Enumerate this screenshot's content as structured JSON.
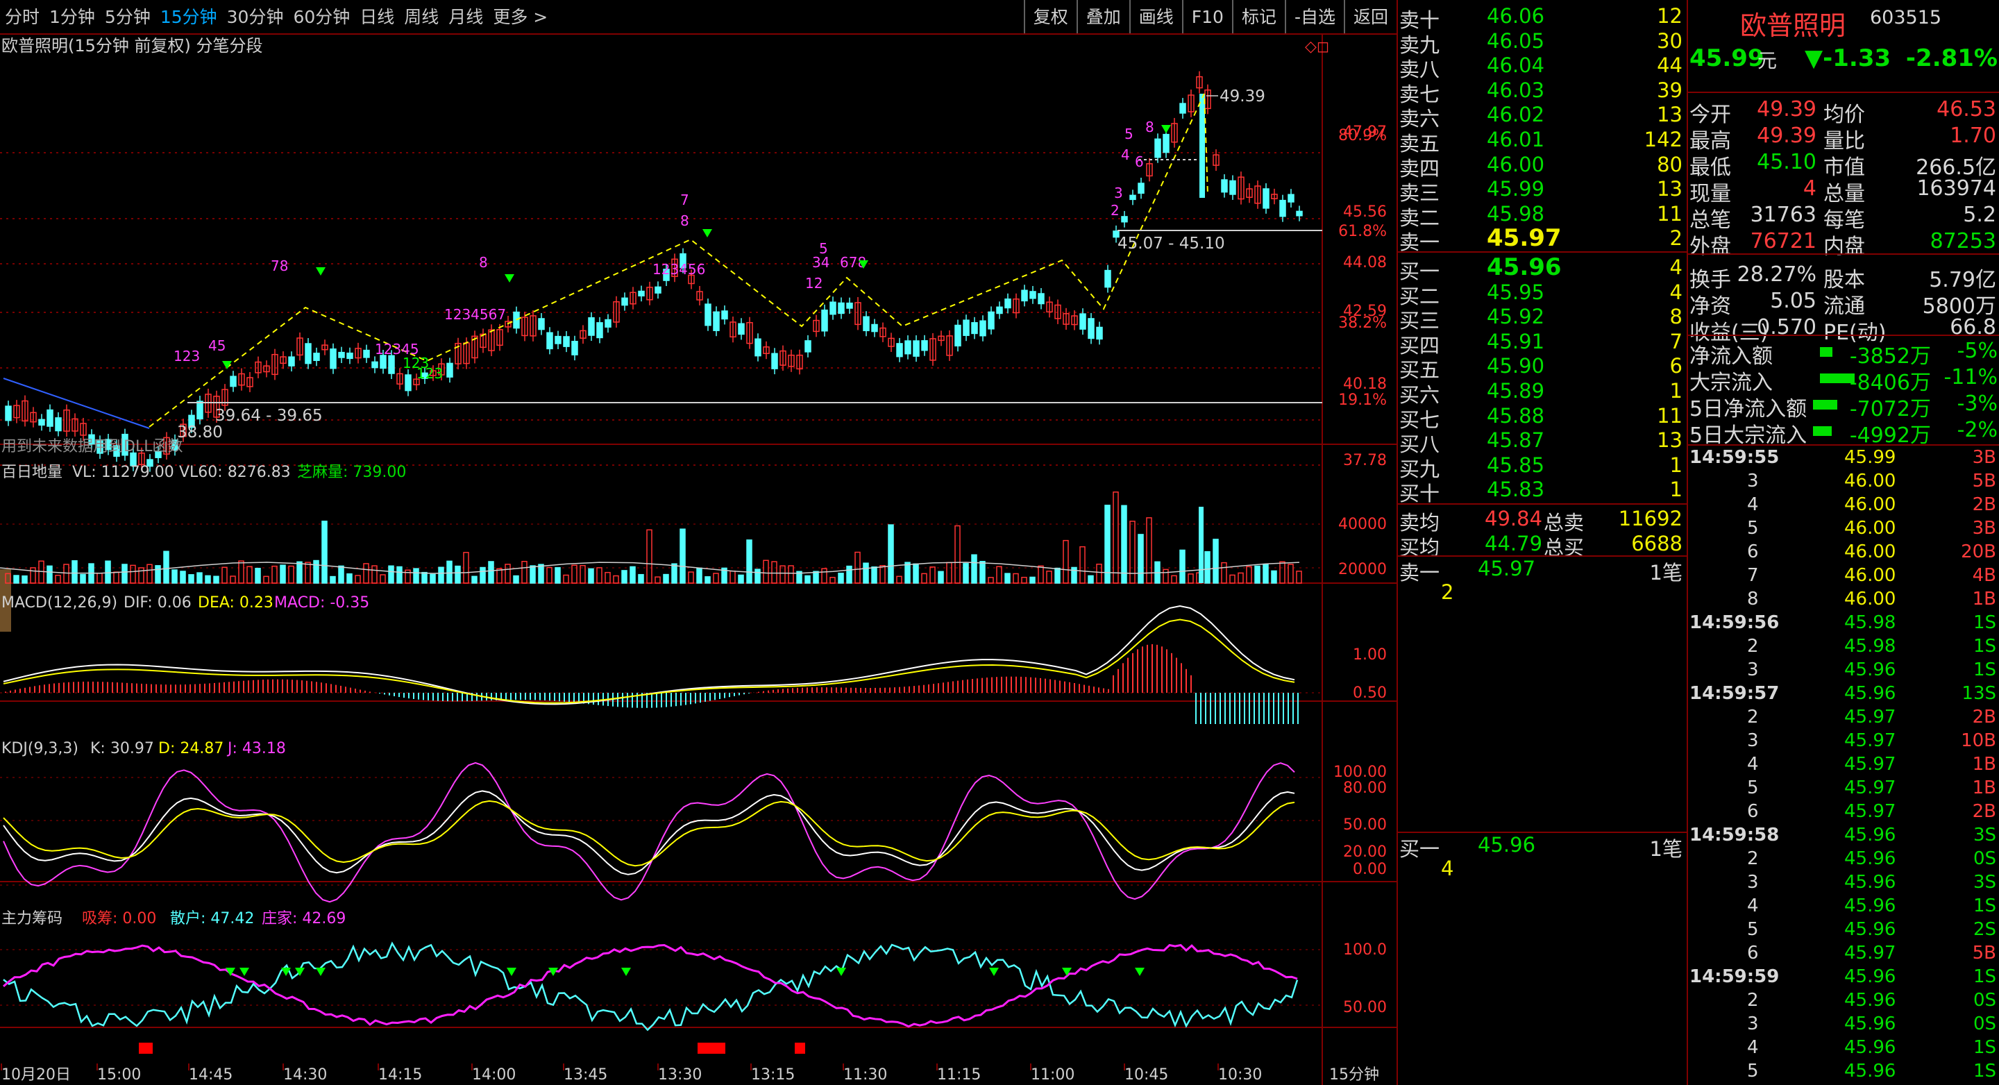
{
  "toolbar": {
    "periods": [
      "分时",
      "1分钟",
      "5分钟",
      "15分钟",
      "30分钟",
      "60分钟",
      "日线",
      "周线",
      "月线",
      "更多 >"
    ],
    "active": 3,
    "right": [
      "复权",
      "叠加",
      "画线",
      "F10",
      "标记",
      "-自选",
      "返回"
    ]
  },
  "main": {
    "title": "欧普照明(15分钟 前复权) 分笔分段",
    "pct_labels": [
      "80.9%",
      "61.8%",
      "38.2%",
      "19.1%"
    ],
    "price_labels": [
      "47.97",
      "45.56",
      "44.08",
      "42.59",
      "40.18",
      "37.78"
    ],
    "hi_label": "49.39",
    "lo_label": "38.80",
    "range1": "45.07 - 45.10",
    "range2": "39.64 - 39.65",
    "note": "用到未来数据用到DLL函数"
  },
  "vol": {
    "name": "百日地量",
    "vl": "VL: 11279.00",
    "vl60": "VL60: 8276.83",
    "zm": "芝麻量: 739.00",
    "ticks": [
      "40000",
      "20000"
    ]
  },
  "macd": {
    "name": "MACD(12,26,9)",
    "dif": "DIF: 0.06",
    "dea": "DEA: 0.23",
    "macd": "MACD: -0.35",
    "ticks": [
      "1.00",
      "0.50"
    ]
  },
  "kdj": {
    "name": "KDJ(9,3,3)",
    "k": "K: 30.97",
    "d": "D: 24.87",
    "j": "J: 43.18",
    "ticks": [
      "100.00",
      "80.00",
      "50.00",
      "20.00",
      "0.00"
    ]
  },
  "zl": {
    "name": "主力筹码",
    "xc": "吸筹: 0.00",
    "sh": "散户: 47.42",
    "zj": "庄家: 42.69",
    "ticks": [
      "100.0",
      "50.00"
    ]
  },
  "xaxis": {
    "labels": [
      "10月20日",
      "15:00",
      "14:45",
      "14:30",
      "14:15",
      "14:00",
      "13:45",
      "13:30",
      "13:15",
      "11:30",
      "11:15",
      "11:00",
      "10:45",
      "10:30"
    ],
    "period": "15分钟"
  },
  "orderbook": {
    "sells": [
      [
        "卖十",
        "46.06",
        "12"
      ],
      [
        "卖九",
        "46.05",
        "30"
      ],
      [
        "卖八",
        "46.04",
        "44"
      ],
      [
        "卖七",
        "46.03",
        "39"
      ],
      [
        "卖六",
        "46.02",
        "13"
      ],
      [
        "卖五",
        "46.01",
        "142"
      ],
      [
        "卖四",
        "46.00",
        "80"
      ],
      [
        "卖三",
        "45.99",
        "13"
      ],
      [
        "卖二",
        "45.98",
        "11"
      ],
      [
        "卖一",
        "45.97",
        "2"
      ]
    ],
    "buys": [
      [
        "买一",
        "45.96",
        "4"
      ],
      [
        "买二",
        "45.95",
        "4"
      ],
      [
        "买三",
        "45.92",
        "8"
      ],
      [
        "买四",
        "45.91",
        "7"
      ],
      [
        "买五",
        "45.90",
        "6"
      ],
      [
        "买六",
        "45.89",
        "1"
      ],
      [
        "买七",
        "45.88",
        "11"
      ],
      [
        "买八",
        "45.87",
        "13"
      ],
      [
        "买九",
        "45.85",
        "1"
      ],
      [
        "买十",
        "45.83",
        "1"
      ]
    ],
    "avg_sell_label": "卖均",
    "avg_sell": "49.84",
    "total_sell_label": "总卖",
    "total_sell": "11692",
    "avg_buy_label": "买均",
    "avg_buy": "44.79",
    "total_buy_label": "总买",
    "total_buy": "6688",
    "q1_label": "卖一",
    "q1_price": "45.97",
    "q1_count": "1笔",
    "q1_qty": "2",
    "q2_label": "买一",
    "q2_price": "45.96",
    "q2_count": "1笔",
    "q2_qty": "4"
  },
  "stock": {
    "name": "欧普照明",
    "code": "603515",
    "price": "45.99",
    "unit": "元",
    "change": "▼-1.33",
    "pct": "-2.81%",
    "rows": [
      [
        "今开",
        "49.39",
        "均价",
        "46.53"
      ],
      [
        "最高",
        "49.39",
        "量比",
        "1.70"
      ],
      [
        "最低",
        "45.10",
        "市值",
        "266.5亿"
      ],
      [
        "现量",
        "4",
        "总量",
        "163974"
      ],
      [
        "总笔",
        "31763",
        "每笔",
        "5.2"
      ],
      [
        "外盘",
        "76721",
        "内盘",
        "87253"
      ],
      [
        "换手",
        "28.27%",
        "股本",
        "5.79亿"
      ],
      [
        "净资",
        "5.05",
        "流通",
        "5800万"
      ],
      [
        "收益(三)",
        "0.570",
        "PE(动)",
        "66.8"
      ]
    ],
    "flows": [
      [
        "净流入额",
        "-3852万",
        "-5%"
      ],
      [
        "大宗流入",
        "-8406万",
        "-11%"
      ],
      [
        "5日净流入额",
        "-7072万",
        "-3%"
      ],
      [
        "5日大宗流入",
        "-4992万",
        "-2%"
      ]
    ]
  },
  "ticks": [
    [
      "14:59:55",
      "45.99",
      "3B"
    ],
    [
      "3",
      "46.00",
      "5B"
    ],
    [
      "4",
      "46.00",
      "2B"
    ],
    [
      "5",
      "46.00",
      "3B"
    ],
    [
      "6",
      "46.00",
      "20B"
    ],
    [
      "7",
      "46.00",
      "4B"
    ],
    [
      "8",
      "46.00",
      "1B"
    ],
    [
      "14:59:56",
      "45.98",
      "1S"
    ],
    [
      "2",
      "45.98",
      "1S"
    ],
    [
      "3",
      "45.96",
      "1S"
    ],
    [
      "14:59:57",
      "45.96",
      "13S"
    ],
    [
      "2",
      "45.97",
      "2B"
    ],
    [
      "3",
      "45.97",
      "10B"
    ],
    [
      "4",
      "45.97",
      "1B"
    ],
    [
      "5",
      "45.97",
      "1B"
    ],
    [
      "6",
      "45.97",
      "2B"
    ],
    [
      "14:59:58",
      "45.96",
      "3S"
    ],
    [
      "2",
      "45.96",
      "0S"
    ],
    [
      "3",
      "45.96",
      "3S"
    ],
    [
      "4",
      "45.96",
      "1S"
    ],
    [
      "5",
      "45.96",
      "2S"
    ],
    [
      "6",
      "45.97",
      "5B"
    ],
    [
      "14:59:59",
      "45.96",
      "1S"
    ],
    [
      "2",
      "45.96",
      "0S"
    ],
    [
      "3",
      "45.96",
      "0S"
    ],
    [
      "4",
      "45.96",
      "1S"
    ],
    [
      "5",
      "45.96",
      "1S"
    ]
  ]
}
